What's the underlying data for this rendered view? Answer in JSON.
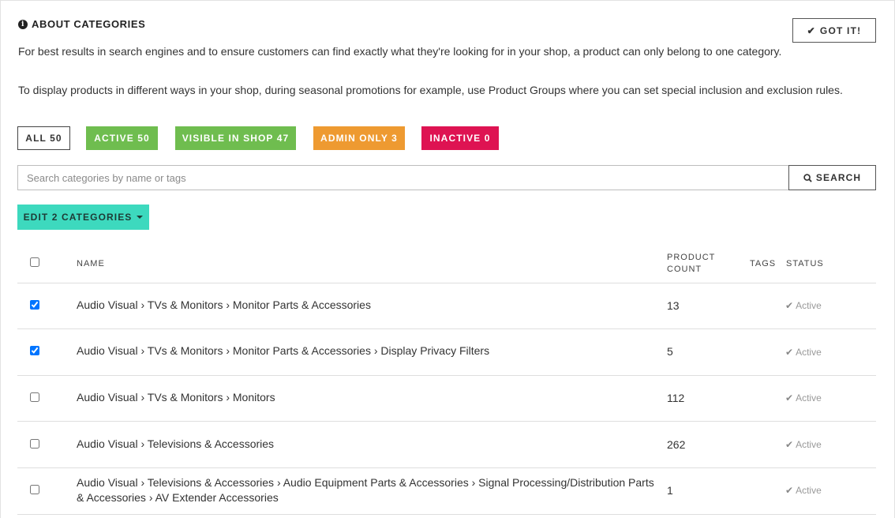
{
  "about": {
    "title": "ABOUT CATEGORIES",
    "icon": "info-icon",
    "paragraph1": "For best results in search engines and to ensure customers can find exactly what they're looking for in your shop, a product can only belong to one category.",
    "paragraph2": "To display products in different ways in your shop, during seasonal promotions for example, use Product Groups where you can set special inclusion and exclusion rules.",
    "got_it_label": "GOT IT!"
  },
  "filters": {
    "all": "ALL 50",
    "active": "ACTIVE 50",
    "visible": "VISIBLE IN SHOP 47",
    "admin_only": "ADMIN ONLY 3",
    "inactive": "INACTIVE 0",
    "colors": {
      "active": "#6fbd4f",
      "admin_only": "#ee9a31",
      "inactive": "#de1352"
    }
  },
  "search": {
    "placeholder": "Search categories by name or tags",
    "value": "",
    "button_label": "SEARCH"
  },
  "edit_button": {
    "label": "EDIT 2 CATEGORIES",
    "color": "#3dd9be"
  },
  "table": {
    "headers": {
      "name": "NAME",
      "product_count_line1": "PRODUCT",
      "product_count_line2": "COUNT",
      "tags": "TAGS",
      "status": "STATUS"
    },
    "rows": [
      {
        "checked": true,
        "name": "Audio Visual › TVs & Monitors › Monitor Parts & Accessories",
        "count": "13",
        "tags": "",
        "status": "Active"
      },
      {
        "checked": true,
        "name": "Audio Visual › TVs & Monitors › Monitor Parts & Accessories › Display Privacy Filters",
        "count": "5",
        "tags": "",
        "status": "Active"
      },
      {
        "checked": false,
        "name": "Audio Visual › TVs & Monitors › Monitors",
        "count": "112",
        "tags": "",
        "status": "Active"
      },
      {
        "checked": false,
        "name": "Audio Visual › Televisions & Accessories",
        "count": "262",
        "tags": "",
        "status": "Active"
      },
      {
        "checked": false,
        "name_line1": "Audio Visual › Televisions & Accessories › Audio Equipment Parts & Accessories › Signal Processing/Distribution Parts",
        "name_line2": "& Accessories › AV Extender Accessories",
        "count": "1",
        "tags": "",
        "status": "Active"
      }
    ]
  }
}
